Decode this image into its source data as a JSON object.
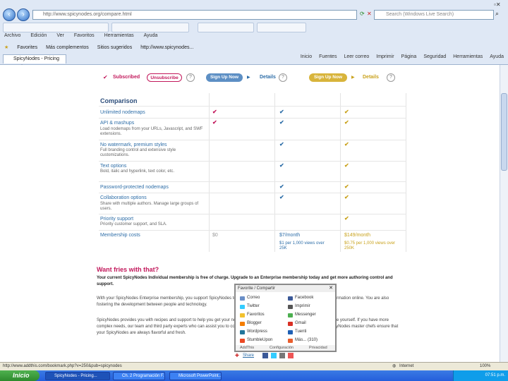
{
  "browser": {
    "address": "http://www.spicynodes.org/compare.html",
    "search_placeholder": "Search (Windows Live Search)",
    "menu": [
      "Archivo",
      "Edición",
      "Ver",
      "Favoritos",
      "Herramientas",
      "Ayuda"
    ],
    "favorites_label": "Favorites",
    "fav_links": [
      "Más complementos",
      "Sitios sugeridos",
      "http://www.spicynodes..."
    ],
    "tab_title": "SpicyNodes - Pricing Options",
    "commands": [
      "Inicio",
      "Fuentes",
      "Leer correo",
      "Imprimir",
      "Página",
      "Seguridad",
      "Herramientas",
      "Ayuda"
    ],
    "status_text": "http://www.addthis.com/bookmark.php?v=250&pub=spicynodes",
    "zone": "Internet",
    "zoom": "100%"
  },
  "pricing": {
    "subscribed": "Subscribed",
    "unsubscribe": "Unsubscribe",
    "signup_1": "Sign Up Now",
    "details_1": "Details",
    "signup_2": "Sign Up Now",
    "details_2": "Details",
    "comparison_title": "Comparison",
    "rows": [
      {
        "label": "Unlimited nodemaps",
        "sub": ""
      },
      {
        "label": "API & mashups",
        "sub": "Load nodemaps from your URLs, Javascript, and SWF extensions."
      },
      {
        "label": "No watermark, premium styles",
        "sub": "Full branding control and extensive style customizations."
      },
      {
        "label": "Text options",
        "sub": "Bold, italic and hyperlink, text color, etc."
      },
      {
        "label": "Password-protected nodemaps",
        "sub": ""
      },
      {
        "label": "Collaboration options",
        "sub": "Share with multiple authors. Manage large groups of users."
      },
      {
        "label": "Priority support",
        "sub": "Priority customer support, and SLA."
      },
      {
        "label": "Membership costs",
        "sub": ""
      }
    ],
    "cost_free": "$0",
    "cost_pro": "$7/month",
    "cost_pro_note": "$1 per 1,000 views over 25K",
    "cost_ent": "$149/month",
    "cost_ent_note": "$0.75 per 1,000 views over 250K"
  },
  "promo": {
    "title": "Want fries with that?",
    "p1": "Your current SpicyNodes Individual membership is free of charge. Upgrade to an Enterprise membership today and get more authoring control and support.",
    "p2": "With your SpicyNodes Enterprise membership, you support SpicyNodes to create innovative ways for people to interact with information online. You are also fostering the development between people and technology.",
    "p3": "SpicyNodes provides you with recipes and support to help you get your nodemaps built. Create, and we encourage you to try one yourself. If you have more complex needs, our team and third party experts who can assist you to connect content, develop content portals and more. SpicyNodes master chefs ensure that your SpicyNodes are always flavorful and fresh.",
    "share": "Share"
  },
  "addthis": {
    "header": "Favorite / Compartir",
    "left": [
      "Correo",
      "Twitter",
      "Favoritos",
      "Blogger",
      "Wordpress",
      "StumbleUpon"
    ],
    "right": [
      "Facebook",
      "Imprimir",
      "Messenger",
      "Gmail",
      "Tuenti",
      "Más... (310)"
    ],
    "footer_left": "AddThis",
    "footer_mid": "Configuración",
    "footer_right": "Privacidad"
  },
  "taskbar": {
    "start": "Inicio",
    "buttons": [
      "SpicyNodes - Pricing...",
      "Ch. 2 Programación F...",
      "Microsoft PowerPoint..."
    ],
    "clock": "07:51 p.m."
  },
  "colors": {
    "accent_pink": "#c2185b",
    "accent_blue": "#2e6ea8",
    "accent_gold": "#c9a21c"
  }
}
